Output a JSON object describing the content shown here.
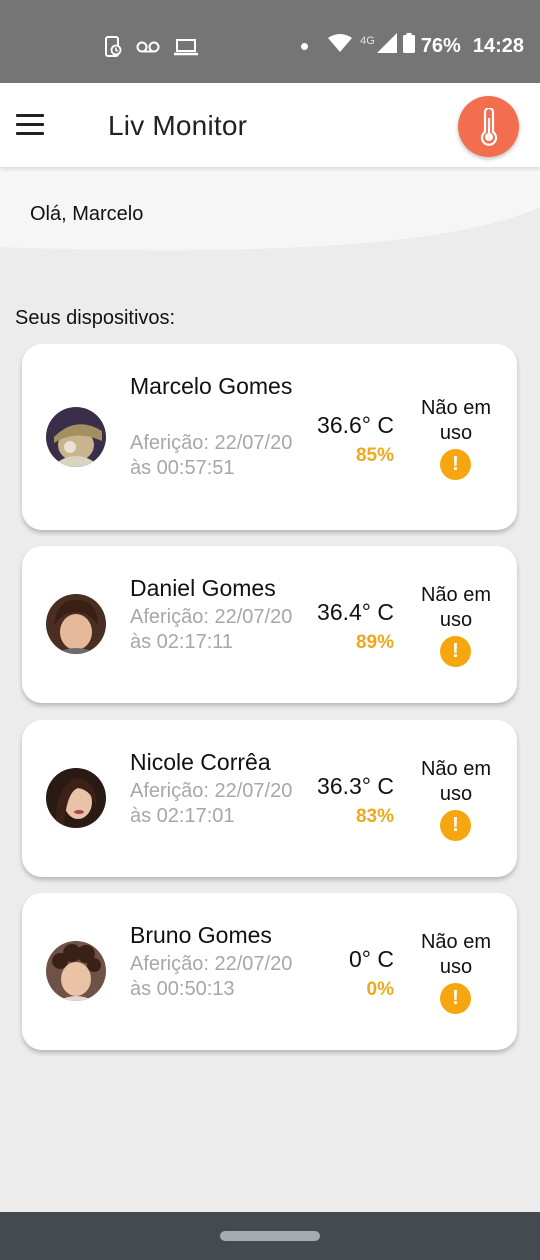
{
  "status_bar": {
    "battery_percent": "76%",
    "time": "14:28",
    "network_type": "4G",
    "icons": [
      "phone-sync-icon",
      "voicemail-icon",
      "laptop-icon",
      "notification-dot-icon",
      "wifi-icon",
      "signal-icon",
      "battery-icon"
    ]
  },
  "app_bar": {
    "title": "Liv Monitor",
    "menu_icon": "hamburger-menu-icon",
    "action_icon": "thermometer-icon",
    "action_color": "#f26e4f"
  },
  "greeting": "Olá, Marcelo",
  "section_title": "Seus dispositivos:",
  "devices": [
    {
      "name": "Marcelo Gomes",
      "measure_label": "Aferição: 22/07/20 às 00:57:51",
      "temperature": "36.6° C",
      "battery": "85%",
      "status": "Não em uso"
    },
    {
      "name": "Daniel Gomes",
      "measure_label": "Aferição: 22/07/20 às 02:17:11",
      "temperature": "36.4° C",
      "battery": "89%",
      "status": "Não em uso"
    },
    {
      "name": "Nicole Corrêa",
      "measure_label": "Aferição: 22/07/20 às 02:17:01",
      "temperature": "36.3° C",
      "battery": "83%",
      "status": "Não em uso"
    },
    {
      "name": "Bruno Gomes",
      "measure_label": "Aferição: 22/07/20 às 00:50:13",
      "temperature": "0° C",
      "battery": "0%",
      "status": "Não em uso"
    }
  ],
  "colors": {
    "accent": "#f26e4f",
    "battery": "#f0a81a",
    "warning": "#f6a70f",
    "status_bar": "#757575",
    "nav_bar": "#434a50"
  }
}
